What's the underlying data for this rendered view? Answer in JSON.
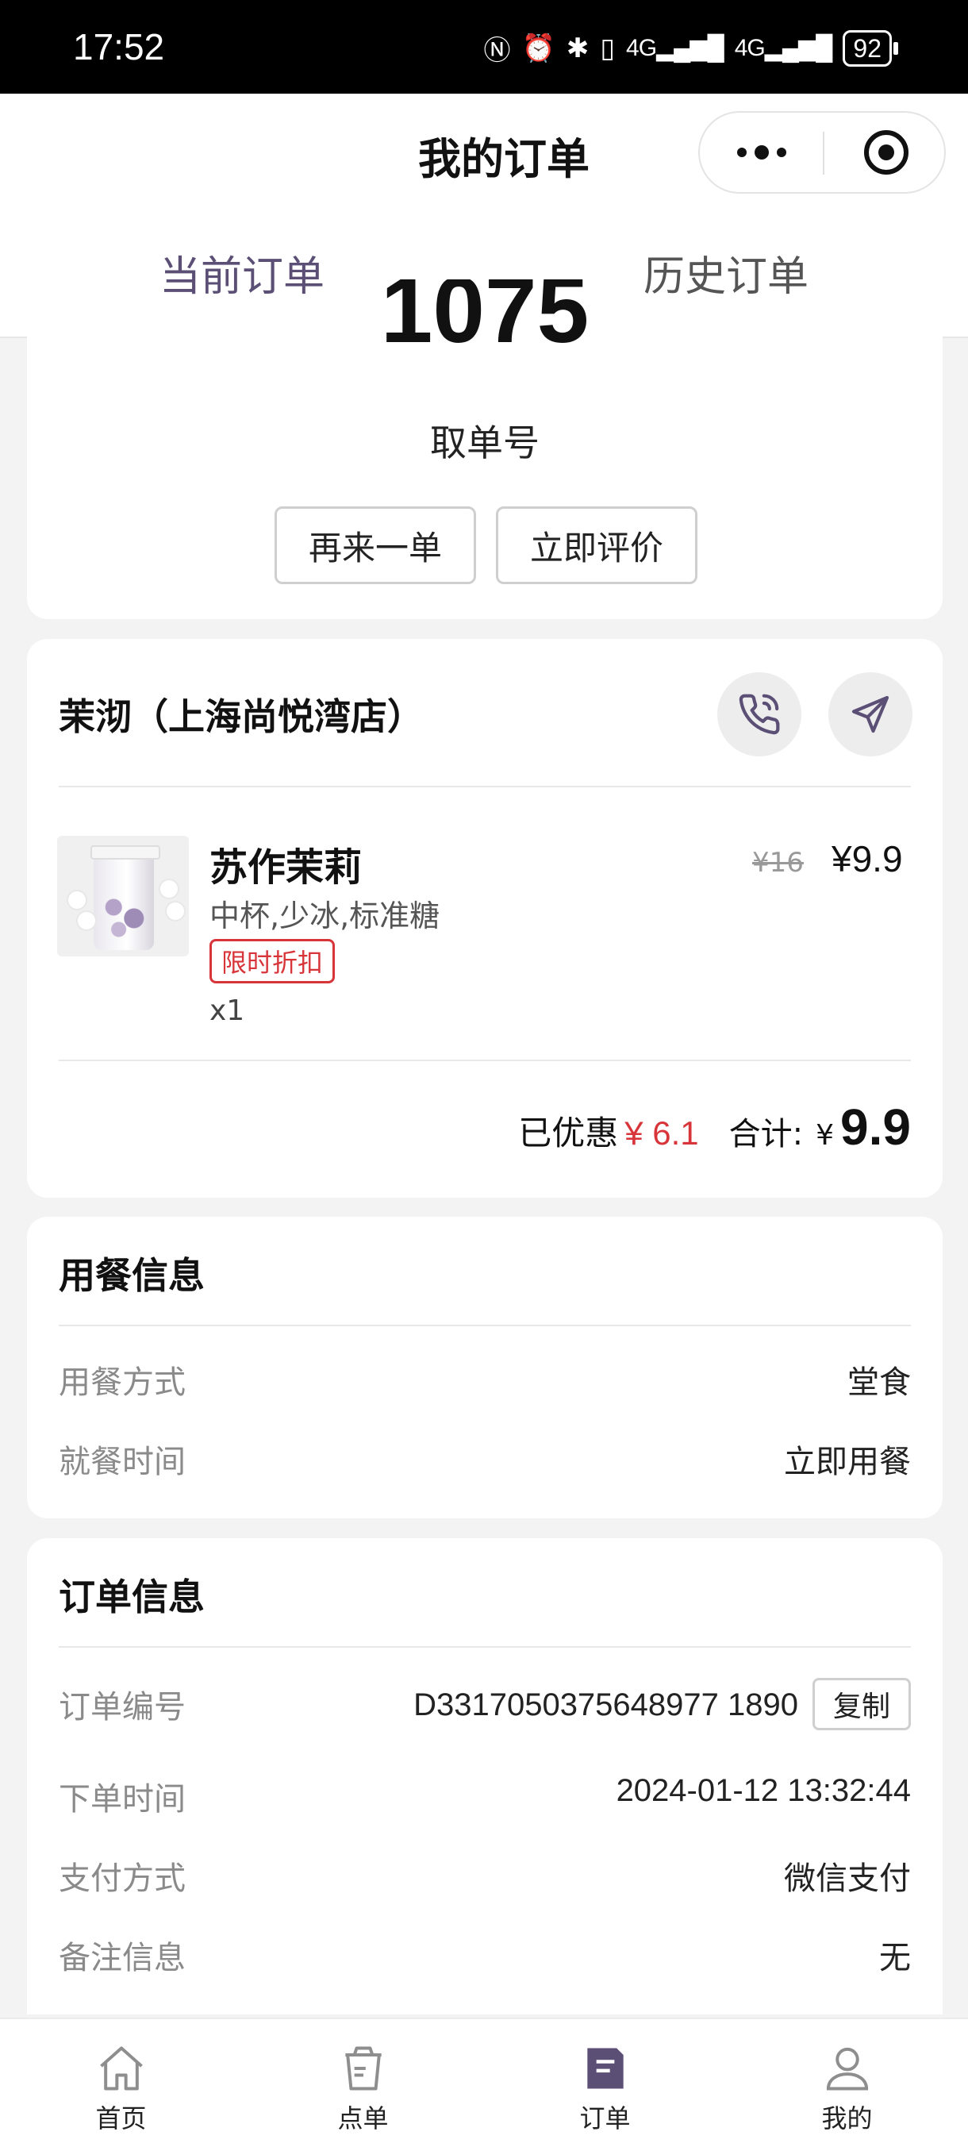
{
  "status_bar": {
    "time": "17:52",
    "network1": "4G",
    "network2": "4G",
    "battery": "92"
  },
  "header": {
    "title": "我的订单"
  },
  "tabs": [
    {
      "label": "当前订单",
      "active": true
    },
    {
      "label": "历史订单",
      "active": false
    }
  ],
  "pickup": {
    "number": "1075",
    "label": "取单号",
    "reorder_label": "再来一单",
    "review_label": "立即评价"
  },
  "store": {
    "name": "茉沏（上海尚悦湾店）",
    "item": {
      "name": "苏作茉莉",
      "spec": "中杯,少冰,标准糖",
      "tag": "限时折扣",
      "qty": "x1",
      "price_original": "¥16",
      "price_current": "¥9.9"
    },
    "discount_label": "已优惠",
    "discount_value": "¥ 6.1",
    "total_label": "合计:",
    "total_currency": "¥",
    "total_value": "9.9"
  },
  "dining": {
    "title": "用餐信息",
    "rows": [
      {
        "label": "用餐方式",
        "value": "堂食"
      },
      {
        "label": "就餐时间",
        "value": "立即用餐"
      }
    ]
  },
  "order": {
    "title": "订单信息",
    "order_no_label": "订单编号",
    "order_no": "D3317050375648977 1890",
    "copy_label": "复制",
    "rows": [
      {
        "label": "下单时间",
        "value": "2024-01-12 13:32:44"
      },
      {
        "label": "支付方式",
        "value": "微信支付"
      },
      {
        "label": "备注信息",
        "value": "无"
      }
    ]
  },
  "tabbar": [
    {
      "label": "首页",
      "icon": "home-icon"
    },
    {
      "label": "点单",
      "icon": "cup-icon"
    },
    {
      "label": "订单",
      "icon": "order-icon",
      "active": true
    },
    {
      "label": "我的",
      "icon": "user-icon"
    }
  ],
  "colors": {
    "accent": "#5b4f76",
    "price_red": "#d8353a"
  }
}
